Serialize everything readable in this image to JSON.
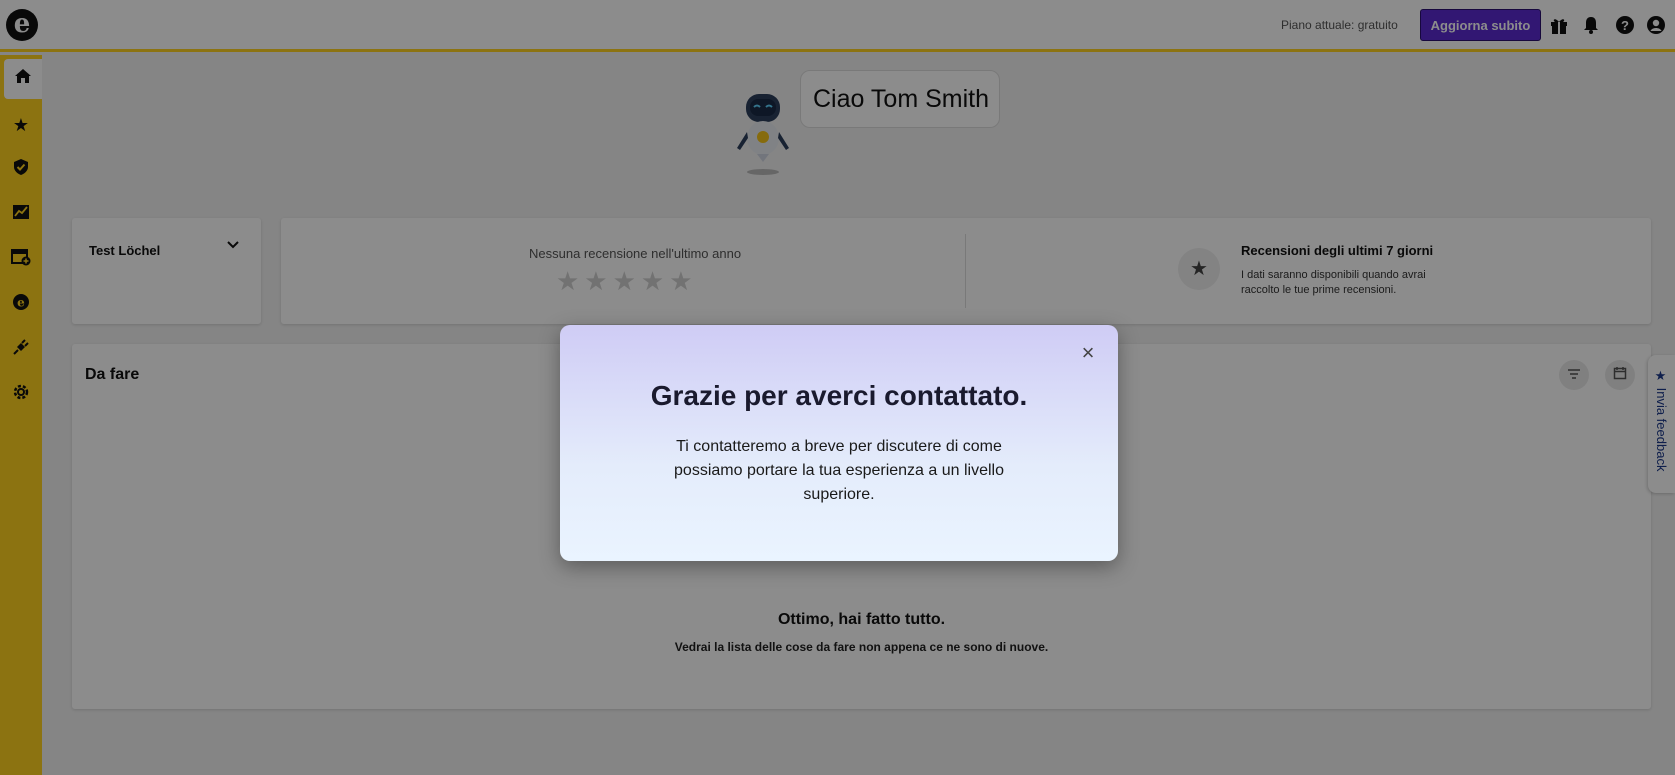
{
  "topbar": {
    "logo_letter": "e",
    "plan_text": "Piano attuale: gratuito",
    "upgrade_label": "Aggiorna subito",
    "icons": [
      "gift-icon",
      "bell-icon",
      "help-icon",
      "user-icon"
    ]
  },
  "sidebar": {
    "items": [
      "home-icon",
      "star-icon",
      "shield-check-icon",
      "chart-icon",
      "calendar-add-icon",
      "coin-icon",
      "plug-icon",
      "settings-icon"
    ]
  },
  "greeting": {
    "text": "Ciao Tom Smith"
  },
  "location": {
    "name": "Test Löchel"
  },
  "stats": {
    "no_review": "Nessuna recensione nell'ultimo anno",
    "stars": "★★★★★",
    "rev7_title": "Recensioni degli ultimi 7 giorni",
    "rev7_desc": "I dati saranno disponibili quando avrai raccolto le tue prime recensioni."
  },
  "todo": {
    "title": "Da fare",
    "done_title": "Ottimo, hai fatto tutto.",
    "done_sub": "Vedrai la lista delle cose da fare non appena ce ne sono di nuove."
  },
  "feedback": {
    "label": "★ Invia feedback"
  },
  "modal": {
    "title": "Grazie per averci contattato.",
    "body": "Ti contatteremo a breve per discutere di come possiamo portare la tua esperienza a un livello superiore.",
    "close": "×"
  }
}
